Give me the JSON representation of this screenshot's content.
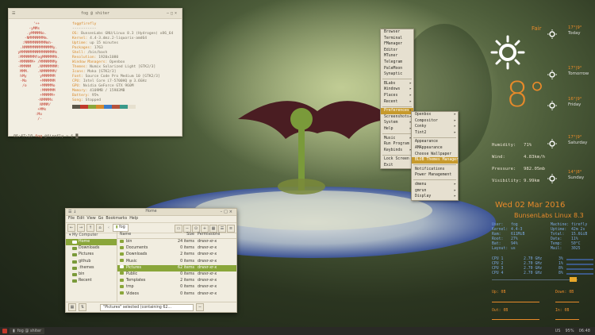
{
  "terminal": {
    "title": "fog @ shiter",
    "ascii_lines": [
      "         '++",
      "       -yMMs",
      "      .yMMMMNo.",
      "     -NMMMMMMMm.",
      "    :MMMMMMMMMMmh-",
      "   .NMMMMMMMMMMMMMy.",
      "  yMMMMMMMMMMMMMMMMs",
      "  :MMMMMMMfogMMMMMMh.",
      "  -MMMMMM+ /MMMMMMMy",
      "  -MMMMM   .NMMMMMMM:",
      "   MMM.    .NMMMMMM/",
      "   hMy      yMMMMMM",
      "   -Mo      +MMMMMM",
      "    /o      +MMMMMo",
      "            :MMMMMM",
      "            +MMMMM+",
      "           -NMMMMs",
      "            NMMM/",
      "           +MMs",
      "          :Mo",
      "           /-"
    ],
    "info_header": "fog@firefly",
    "info_rule": "-----------",
    "info": [
      {
        "k": "OS:",
        "v": "BunsenLabs GNU/Linux 8.3 (Hydrogen) x86_64"
      },
      {
        "k": "Kernel:",
        "v": "4.4-3.dmz.2-liquorix-amd64"
      },
      {
        "k": "Uptime:",
        "v": "up 15 minutes"
      },
      {
        "k": "Packages:",
        "v": "1763"
      },
      {
        "k": "Shell:",
        "v": "/bin/bash"
      },
      {
        "k": "Resolution:",
        "v": "1920x1080"
      },
      {
        "k": "Window Managers:",
        "v": "Openbox"
      },
      {
        "k": "Themes:",
        "v": "Numix Solarized Light [GTK2/3]"
      },
      {
        "k": "Icons:",
        "v": "Moka [GTK2/3]"
      },
      {
        "k": "Font:",
        "v": "Source Code Pro Medium 10 [GTK2/3]"
      },
      {
        "k": "CPU:",
        "v": "Intel Core i7-5700HQ @ 3.6GHz"
      },
      {
        "k": "GPU:",
        "v": "Nvidia GeForce GTX 960M"
      },
      {
        "k": "Memory:",
        "v": "4109MB / 15983MB"
      },
      {
        "k": "Battery:",
        "v": "95%"
      },
      {
        "k": "Song:",
        "v": "Stopped"
      }
    ],
    "palette": [
      "#5a5548",
      "#c0392b",
      "#8aa63a",
      "#d88a2c",
      "#3b7dc9",
      "#b5533c",
      "#3a9a8a",
      "#e6e0cf"
    ],
    "prompt_time": "06:47:10",
    "prompt_user": "fog",
    "prompt_host": "@firefly",
    "prompt_path": "~ $"
  },
  "root_menu": {
    "items": [
      {
        "label": "Browser",
        "sub": false
      },
      {
        "label": "Terminal",
        "sub": false
      },
      {
        "label": "FManager",
        "sub": false
      },
      {
        "label": "Editor",
        "sub": false
      },
      {
        "label": "MTuner",
        "sub": false
      },
      {
        "label": "Telegram",
        "sub": false
      },
      {
        "label": "PaleMoon",
        "sub": false
      },
      {
        "label": "Synaptic",
        "sub": false
      },
      {
        "label": "BLabs",
        "sub": true
      },
      {
        "label": "Windows",
        "sub": true
      },
      {
        "label": "Places",
        "sub": true
      },
      {
        "label": "Recent",
        "sub": true
      },
      {
        "label": "Preferences",
        "sub": true
      },
      {
        "label": "Screenshots",
        "sub": true
      },
      {
        "label": "System",
        "sub": true
      },
      {
        "label": "Help",
        "sub": true
      },
      {
        "label": "Music",
        "sub": true
      },
      {
        "label": "Run Program",
        "sub": false
      },
      {
        "label": "Keybinds",
        "sub": true
      },
      {
        "label": "Lock Screen",
        "sub": false
      },
      {
        "label": "Exit",
        "sub": false
      }
    ]
  },
  "prefs_menu": {
    "items": [
      {
        "label": "Openbox",
        "sub": true
      },
      {
        "label": "Compositor",
        "sub": true
      },
      {
        "label": "Conky",
        "sub": true
      },
      {
        "label": "Tint2",
        "sub": true
      },
      {
        "label": "Appearance",
        "sub": false
      },
      {
        "label": "AMAppearance",
        "sub": false
      },
      {
        "label": "Choose Wallpaper",
        "sub": false
      },
      {
        "label": "BLOB Themes Manager",
        "sub": false
      },
      {
        "label": "Notifications",
        "sub": false
      },
      {
        "label": "Power Management",
        "sub": false
      },
      {
        "label": "dmenu",
        "sub": true
      },
      {
        "label": "gmrun",
        "sub": true
      },
      {
        "label": "Display",
        "sub": true
      }
    ]
  },
  "weather": {
    "condition": "Fair",
    "current_temp": "8°",
    "forecast": [
      {
        "temp": "17°|9°",
        "day": "Today"
      },
      {
        "temp": "17°|9°",
        "day": "Tomorrow"
      },
      {
        "temp": "16°|9°",
        "day": "Friday"
      },
      {
        "temp": "17°|9°",
        "day": "Saturday"
      },
      {
        "temp": "14°|8°",
        "day": "Sunday"
      }
    ],
    "stats": [
      {
        "k": "Humidity:",
        "v": "71%"
      },
      {
        "k": "Wind:",
        "v": "4.83km/h"
      },
      {
        "k": "Pressure:",
        "v": "982.05mb"
      },
      {
        "k": "Visibility:",
        "v": "9.99km"
      }
    ],
    "accent": "#e88a2a"
  },
  "conky": {
    "date": "Wed 02 Mar 2016",
    "distro": "BunsenLabs Linux 8.3",
    "sys_rows": [
      [
        "User:",
        "fog",
        "Machine:",
        "firefly"
      ],
      [
        "Kernel:",
        "4.4-3",
        "Uptime:",
        "42m 2s"
      ],
      [
        "Ram:",
        "611MiB",
        "Total:",
        "15.6GiB"
      ],
      [
        "Root:",
        "27%",
        "Data:",
        "11%"
      ],
      [
        "Bat:",
        "94%",
        "Temp:",
        "50°C"
      ],
      [
        "Layout:",
        "us",
        "Mail:",
        "3025"
      ]
    ],
    "cpus": [
      {
        "label": "CPU 1",
        "freq": "2.70 GHz",
        "pct": "3%"
      },
      {
        "label": "CPU 2",
        "freq": "2.70 GHz",
        "pct": "1%"
      },
      {
        "label": "CPU 3",
        "freq": "2.70 GHz",
        "pct": "8%"
      },
      {
        "label": "CPU 4",
        "freq": "2.70 GHz",
        "pct": "8%"
      }
    ],
    "net_up": "Up: 0B",
    "net_down": "Down: 0B",
    "net_out": "Out: 0B",
    "net_in": "In: 0B",
    "color_blue": "#7aa6e0"
  },
  "filemanager": {
    "title": "Home",
    "menu": [
      "File",
      "Edit",
      "View",
      "Go",
      "Bookmarks",
      "Help"
    ],
    "path": "fog",
    "sidebar_header": "My Computer",
    "sidebar": [
      "Home",
      "Downloads",
      "Pictures",
      "github",
      ".themes",
      "bin",
      "Recent"
    ],
    "columns": {
      "name": "Name",
      "size": "Size",
      "perms": "Permissions"
    },
    "rows": [
      {
        "name": "bin",
        "size": "24 items",
        "perms": "drwxr-xr-x"
      },
      {
        "name": "Documents",
        "size": "0 items",
        "perms": "drwxr-xr-x"
      },
      {
        "name": "Downloads",
        "size": "2 items",
        "perms": "drwxr-xr-x"
      },
      {
        "name": "Music",
        "size": "0 items",
        "perms": "drwxr-xr-x"
      },
      {
        "name": "Pictures",
        "size": "62 items",
        "perms": "drwxr-xr-x"
      },
      {
        "name": "Public",
        "size": "0 items",
        "perms": "drwxr-xr-x"
      },
      {
        "name": "Templates",
        "size": "2 items",
        "perms": "drwxr-xr-x"
      },
      {
        "name": "tmp",
        "size": "0 items",
        "perms": "drwxr-xr-x"
      },
      {
        "name": "Videos",
        "size": "0 items",
        "perms": "drwxr-xr-x"
      }
    ],
    "status": "\"Pictures\" selected (containing 62...",
    "accent": "#8aa63a"
  },
  "taskbar": {
    "task": "fog @ shiter",
    "right": [
      "US",
      "95%",
      "06:48"
    ]
  }
}
